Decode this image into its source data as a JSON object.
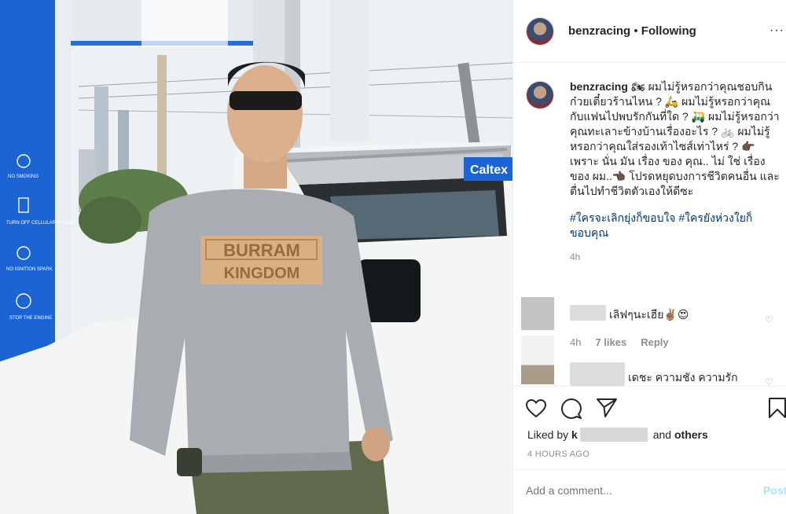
{
  "post": {
    "photo_texts": {
      "sweatshirt_line1": "BURRAM",
      "sweatshirt_line2": "KINGDOM",
      "sign_no_smoking": "NO SMOKING",
      "sign_turn_off": "TURN OFF CELLULAR PHONE",
      "sign_no_ignition": "NO IGNITION SPARK",
      "sign_stop_engine": "STOP THE ENGINE",
      "building_sign": "Caltex"
    },
    "header": {
      "username": "benzracing",
      "separator": " • ",
      "follow_status": "Following",
      "more_icon": "more-icon",
      "more_glyph": "···"
    },
    "caption": {
      "username": "benzracing",
      "text": "🏍 ผมไม่รู้หรอกว่าคุณชอบกินก๋วยเตี๋ยวร้านไหน ? 🛵 ผมไม่รู้หรอกว่าคุณกับแฟนไปพบรักกันที่ใด ? 🛺 ผมไม่รู้หรอกว่าคุณทะเลาะข้างบ้านเรื่องอะไร ? 🚲 ผมไม่รู้หรอกว่าคุณใส่รองเท้าไซส์เท่าไหร่ ? 👉🏿 เพราะ นั่น มัน เรื่อง ของ คุณ.. ไม่ ใช่ เรื่อง ของ ผม..👈🏿 โปรดหยุดบงการชีวิตคนอื่น และตื่นไปทำชีวิตตัวเองให้ดีซะ",
      "hashtags": "#ใครจะเลิกยุ่งก็ขอบใจ #ใครยังห่วงใยก็ขอบคุณ",
      "time": "4h"
    },
    "comments": [
      {
        "text": "เลิฟๆนะเฮีย✌🏽😍",
        "time": "4h",
        "likes": "7 likes",
        "reply": "Reply"
      },
      {
        "text": "เดชะ ความชัง ความรัก"
      }
    ],
    "actions": {
      "liked_prefix": "Liked by",
      "liked_user_initial": "k",
      "liked_suffix_and": "and",
      "liked_others": "others",
      "timestamp": "4 HOURS AGO"
    },
    "add_comment": {
      "placeholder": "Add a comment...",
      "post_label": "Post"
    },
    "colors": {
      "link": "#00376b",
      "post_button_disabled": "#b2dffc",
      "muted": "#8e8e8e"
    }
  }
}
